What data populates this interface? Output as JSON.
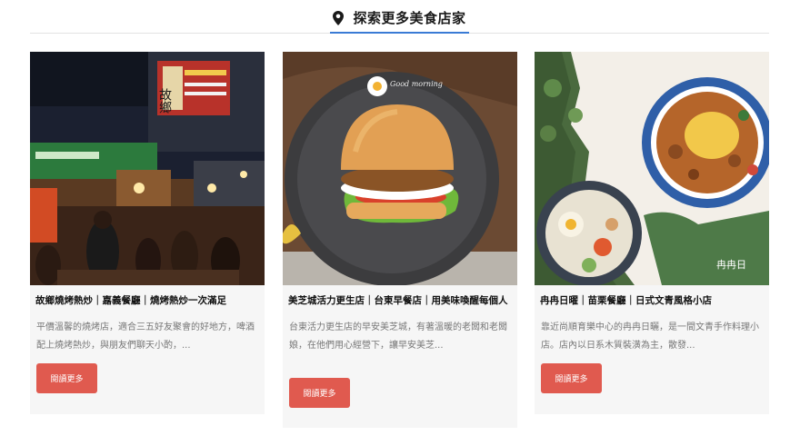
{
  "section": {
    "title": "探索更多美食店家",
    "icon": "map-pin-icon",
    "accent_color": "#3a7bd5"
  },
  "cards": [
    {
      "title": "故鄉燒烤熱炒｜嘉義餐廳｜燒烤熱炒一次滿足",
      "desc": "平價溫馨的燒烤店，適合三五好友聚會的好地方，啤酒配上燒烤熱炒，與朋友們聊天小酌，...",
      "button": "閱讀更多",
      "sign_text": "故鄉"
    },
    {
      "title": "美芝城活力更生店｜台東早餐店｜用美味喚醒每個人",
      "desc": "台東活力更生店的早安美芝城，有著溫暖的老闆和老闆娘，在他們用心經營下，讓早安美芝...",
      "button": "閱讀更多",
      "plate_text": "Good morning"
    },
    {
      "title": "冉冉日曜｜苗栗餐廳｜日式文青風格小店",
      "desc": "靠近尚順育樂中心的冉冉日曬，是一間文青手作料理小店。店內以日系木質裝潢為主，散發...",
      "button": "閱讀更多",
      "img_text": "冉冉日"
    }
  ],
  "colors": {
    "button": "#e05a4f",
    "card_bg": "#f6f6f6"
  }
}
